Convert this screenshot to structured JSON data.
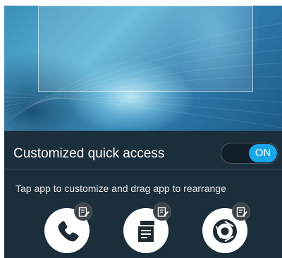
{
  "quick_access": {
    "title": "Customized quick access",
    "toggle_label": "ON",
    "toggle_state": "on",
    "hint": "Tap app to customize and drag app to rearrange",
    "apps": [
      {
        "icon": "phone-icon"
      },
      {
        "icon": "notes-icon"
      },
      {
        "icon": "chrome-icon"
      }
    ],
    "edit_badge_icon": "edit-icon"
  },
  "colors": {
    "toggle_on": "#18a6e8",
    "panel_bg": "#1c2c38",
    "badge_bg": "#3b4248"
  }
}
